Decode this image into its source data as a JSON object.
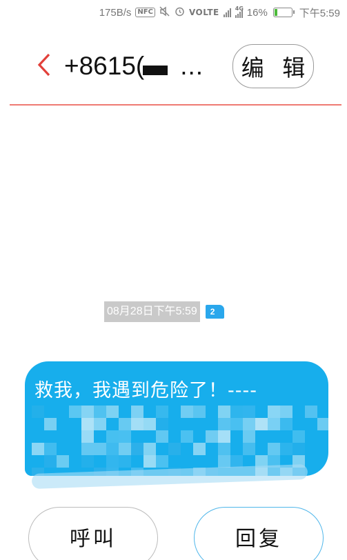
{
  "status_bar": {
    "speed": "175B/s",
    "nfc": "NFC",
    "volte": "VOLTE",
    "network": "4G",
    "battery": "16%",
    "time": "下午5:59"
  },
  "header": {
    "back_icon": "chevron-left-icon",
    "title_prefix": "+8615(",
    "title_suffix": "...",
    "edit_label": "编 辑"
  },
  "conversation": {
    "timestamp": "08月28日下午5:59",
    "sim_badge": "2",
    "message_text": "救我，我遇到危险了！----"
  },
  "actions": {
    "call_label": "呼叫",
    "reply_label": "回复"
  },
  "colors": {
    "accent": "#ef7a72",
    "back_arrow": "#e2403a",
    "bubble": "#17aeec",
    "badge": "#2aa7ec",
    "battery_fill": "#4cba3a"
  }
}
